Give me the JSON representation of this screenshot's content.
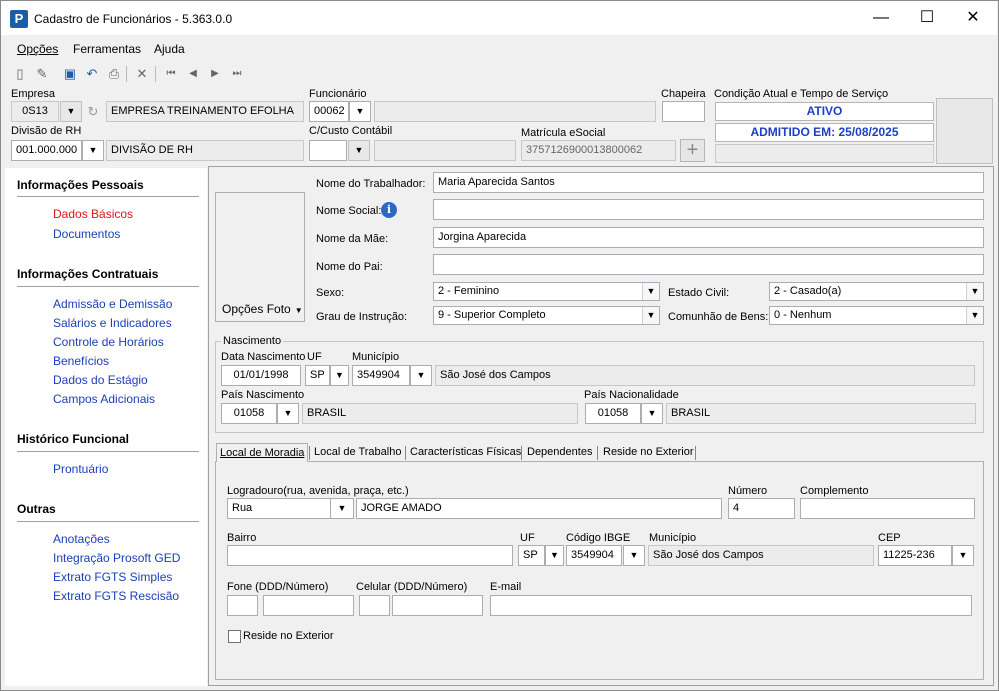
{
  "window": {
    "title": "Cadastro de Funcionários - 5.363.0.0",
    "app_icon_letter": "P",
    "minimize": "—",
    "maximize": "☐",
    "close": "✕"
  },
  "menu": [
    "Opções",
    "Ferramentas",
    "Ajuda"
  ],
  "toolbar": {
    "icons": [
      "new-icon",
      "edit-icon",
      "save-icon",
      "undo-icon",
      "print-icon",
      "delete-icon",
      "first-icon",
      "prev-icon",
      "next-icon",
      "last-icon"
    ],
    "glyphs": [
      "▯",
      "✎",
      "▣",
      "↶",
      "⎙",
      "✕",
      "⏮",
      "◀",
      "▶",
      "⏭"
    ]
  },
  "header": {
    "empresa_label": "Empresa",
    "empresa_code": "0S13",
    "empresa_name": "EMPRESA TREINAMENTO EFOLHA",
    "funcionario_label": "Funcionário",
    "funcionario_code": "00062",
    "funcionario_name": "",
    "chapeira_label": "Chapeira",
    "chapeira_value": "",
    "divisao_label": "Divisão de RH",
    "divisao_code": "001.000.000",
    "divisao_name": "DIVISÃO DE RH",
    "custo_label": "C/Custo Contábil",
    "custo_code": "",
    "custo_name": "",
    "matricula_label": "Matrícula eSocial",
    "matricula_value": "3757126900013800062",
    "condicao_label": "Condição Atual e Tempo de Serviço",
    "status": "ATIVO",
    "admissao": "ADMITIDO EM: 25/08/2025",
    "status_extra": ""
  },
  "sidebar": {
    "sections": [
      {
        "title": "Informações Pessoais",
        "items": [
          "Dados Básicos",
          "Documentos"
        ]
      },
      {
        "title": "Informações Contratuais",
        "items": [
          "Admissão e Demissão",
          "Salários e Indicadores",
          "Controle de Horários",
          "Benefícios",
          "Dados do Estágio",
          "Campos Adicionais"
        ]
      },
      {
        "title": "Histórico Funcional",
        "items": [
          "Prontuário"
        ]
      },
      {
        "title": "Outras",
        "items": [
          "Anotações",
          "Integração Prosoft GED",
          "Extrato FGTS Simples",
          "Extrato FGTS Rescisão"
        ]
      }
    ]
  },
  "personal": {
    "foto_button": "Opções Foto",
    "nome_label": "Nome do Trabalhador:",
    "nome_value": "Maria Aparecida Santos",
    "social_label": "Nome Social:",
    "social_value": "",
    "mae_label": "Nome da Mãe:",
    "mae_value": "Jorgina Aparecida",
    "pai_label": "Nome do Pai:",
    "pai_value": "",
    "sexo_label": "Sexo:",
    "sexo_value": "2 - Feminino",
    "civil_label": "Estado Civil:",
    "civil_value": "2 - Casado(a)",
    "grau_label": "Grau de Instrução:",
    "grau_value": "9 - Superior Completo",
    "comunhao_label": "Comunhão de Bens:",
    "comunhao_value": "0 - Nenhum"
  },
  "nascimento": {
    "group_label": "Nascimento",
    "data_label": "Data Nascimento",
    "data_value": "01/01/1998",
    "uf_label": "UF",
    "uf_value": "SP",
    "municipio_label": "Município",
    "municipio_code": "3549904",
    "municipio_name": "São José dos Campos",
    "pais_nasc_label": "País Nascimento",
    "pais_nasc_code": "01058",
    "pais_nasc_name": "BRASIL",
    "pais_nac_label": "País Nacionalidade",
    "pais_nac_code": "01058",
    "pais_nac_name": "BRASIL"
  },
  "tabs": [
    "Local de Moradia",
    "Local de Trabalho",
    "Características Físicas",
    "Dependentes",
    "Reside no Exterior"
  ],
  "moradia": {
    "logradouro_label": "Logradouro(rua, avenida, praça, etc.)",
    "tipo_value": "Rua",
    "logradouro_value": "JORGE AMADO",
    "numero_label": "Número",
    "numero_value": "4",
    "complemento_label": "Complemento",
    "complemento_value": "",
    "bairro_label": "Bairro",
    "bairro_value": "",
    "uf_label": "UF",
    "uf_value": "SP",
    "ibge_label": "Código IBGE",
    "ibge_value": "3549904",
    "municipio_label": "Município",
    "municipio_value": "São José dos Campos",
    "cep_label": "CEP",
    "cep_value": "11225-236",
    "fone_label": "Fone (DDD/Número)",
    "celular_label": "Celular (DDD/Número)",
    "email_label": "E-mail",
    "exterior_label": "Reside no Exterior"
  },
  "colors": {
    "link": "#1a3fb8",
    "active_link": "#e01515",
    "status": "#1c3fc4"
  }
}
